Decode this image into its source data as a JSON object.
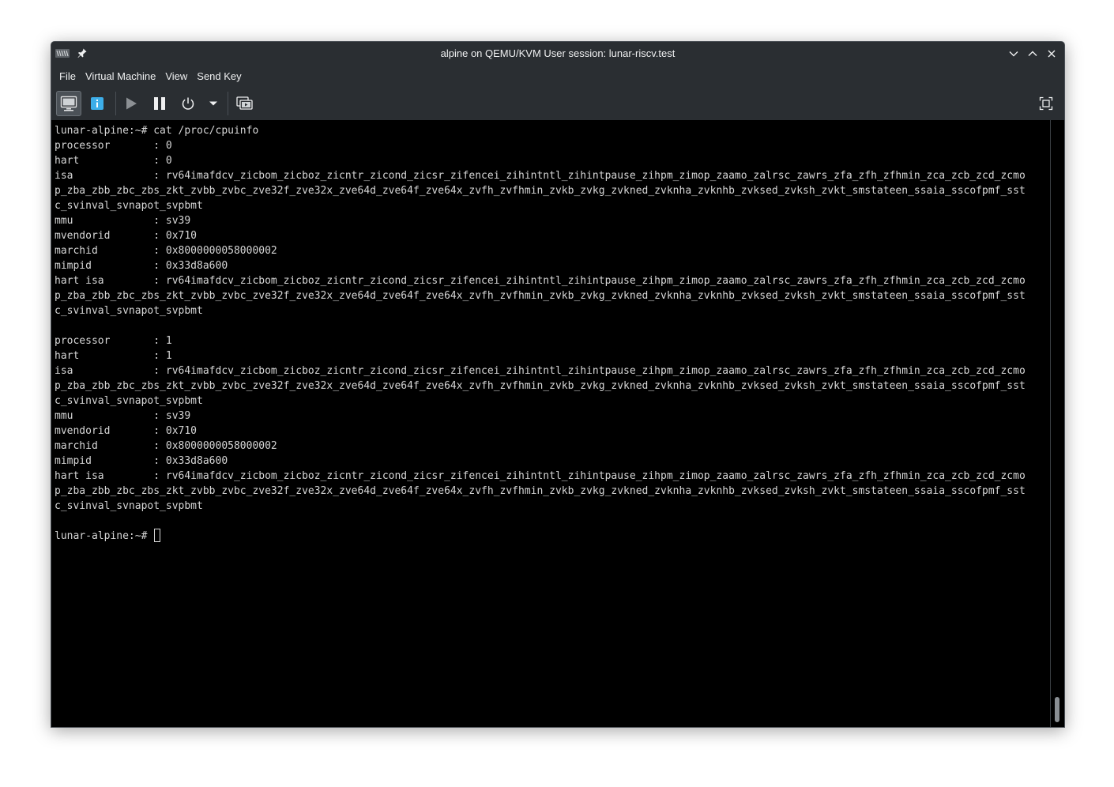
{
  "window": {
    "title": "alpine on QEMU/KVM User session: lunar-riscv.test"
  },
  "menubar": {
    "items": [
      "File",
      "Virtual Machine",
      "View",
      "Send Key"
    ]
  },
  "toolbar": {
    "icons": [
      "console-view-icon",
      "details-info-icon",
      "run-icon",
      "pause-icon",
      "power-icon",
      "power-menu-chevron-icon",
      "snapshots-icon",
      "fullscreen-icon"
    ]
  },
  "colors": {
    "chrome": "#2a2e32",
    "console_bg": "#000000",
    "console_text": "#d6d6d6",
    "info_blue": "#3daee9"
  },
  "console": {
    "lines": [
      "lunar-alpine:~# cat /proc/cpuinfo",
      "processor       : 0",
      "hart            : 0",
      "isa             : rv64imafdcv_zicbom_zicboz_zicntr_zicond_zicsr_zifencei_zihintntl_zihintpause_zihpm_zimop_zaamo_zalrsc_zawrs_zfa_zfh_zfhmin_zca_zcb_zcd_zcmo",
      "p_zba_zbb_zbc_zbs_zkt_zvbb_zvbc_zve32f_zve32x_zve64d_zve64f_zve64x_zvfh_zvfhmin_zvkb_zvkg_zvkned_zvknha_zvknhb_zvksed_zvksh_zvkt_smstateen_ssaia_sscofpmf_sst",
      "c_svinval_svnapot_svpbmt",
      "mmu             : sv39",
      "mvendorid       : 0x710",
      "marchid         : 0x8000000058000002",
      "mimpid          : 0x33d8a600",
      "hart isa        : rv64imafdcv_zicbom_zicboz_zicntr_zicond_zicsr_zifencei_zihintntl_zihintpause_zihpm_zimop_zaamo_zalrsc_zawrs_zfa_zfh_zfhmin_zca_zcb_zcd_zcmo",
      "p_zba_zbb_zbc_zbs_zkt_zvbb_zvbc_zve32f_zve32x_zve64d_zve64f_zve64x_zvfh_zvfhmin_zvkb_zvkg_zvkned_zvknha_zvknhb_zvksed_zvksh_zvkt_smstateen_ssaia_sscofpmf_sst",
      "c_svinval_svnapot_svpbmt",
      "",
      "processor       : 1",
      "hart            : 1",
      "isa             : rv64imafdcv_zicbom_zicboz_zicntr_zicond_zicsr_zifencei_zihintntl_zihintpause_zihpm_zimop_zaamo_zalrsc_zawrs_zfa_zfh_zfhmin_zca_zcb_zcd_zcmo",
      "p_zba_zbb_zbc_zbs_zkt_zvbb_zvbc_zve32f_zve32x_zve64d_zve64f_zve64x_zvfh_zvfhmin_zvkb_zvkg_zvkned_zvknha_zvknhb_zvksed_zvksh_zvkt_smstateen_ssaia_sscofpmf_sst",
      "c_svinval_svnapot_svpbmt",
      "mmu             : sv39",
      "mvendorid       : 0x710",
      "marchid         : 0x8000000058000002",
      "mimpid          : 0x33d8a600",
      "hart isa        : rv64imafdcv_zicbom_zicboz_zicntr_zicond_zicsr_zifencei_zihintntl_zihintpause_zihpm_zimop_zaamo_zalrsc_zawrs_zfa_zfh_zfhmin_zca_zcb_zcd_zcmo",
      "p_zba_zbb_zbc_zbs_zkt_zvbb_zvbc_zve32f_zve32x_zve64d_zve64f_zve64x_zvfh_zvfhmin_zvkb_zvkg_zvkned_zvknha_zvknhb_zvksed_zvksh_zvkt_smstateen_ssaia_sscofpmf_sst",
      "c_svinval_svnapot_svpbmt",
      ""
    ],
    "prompt": "lunar-alpine:~# "
  }
}
